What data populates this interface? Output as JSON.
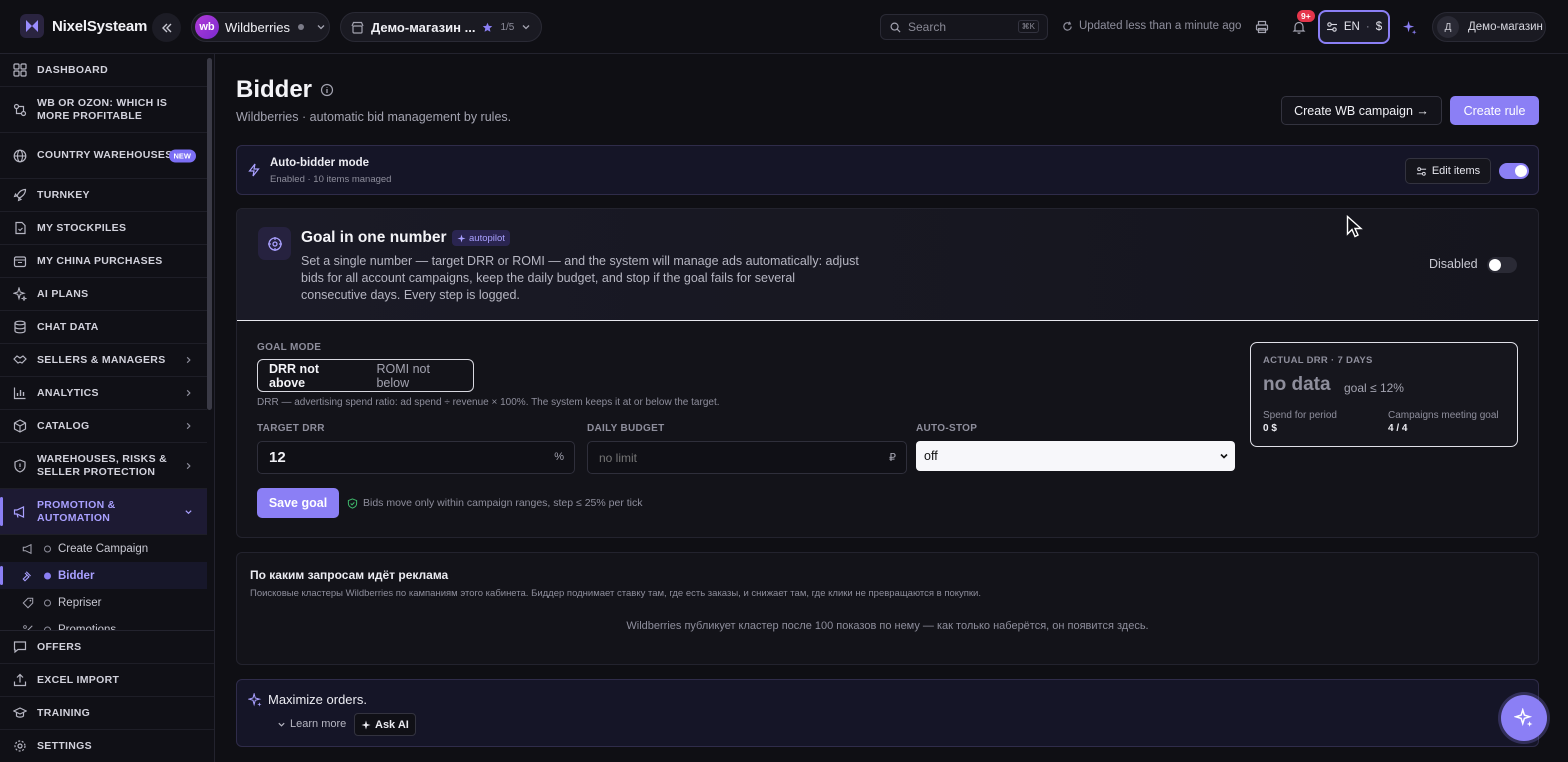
{
  "app": {
    "name": "NixelSysteam"
  },
  "topbar": {
    "marketplace": {
      "badge": "wb",
      "label": "Wildberries"
    },
    "store": {
      "label": "Демо-магазин ...",
      "count": "1/5"
    },
    "search": {
      "placeholder": "Search",
      "shortcut": "⌘K"
    },
    "updated": "Updated less than a minute ago",
    "notifications_badge": "9+",
    "lang": "EN",
    "currency": "$",
    "user": {
      "initial": "Д",
      "name": "Демо-магазин"
    }
  },
  "sidebar": {
    "items": [
      {
        "label": "Dashboard",
        "icon": "grid-icon"
      },
      {
        "label": "WB or Ozon: which is more profitable",
        "icon": "compare-icon"
      },
      {
        "label": "Country warehouses",
        "icon": "globe-icon",
        "badge": "NEW"
      },
      {
        "label": "Turnkey",
        "icon": "rocket-icon"
      },
      {
        "label": "My stockpiles",
        "icon": "box-icon"
      },
      {
        "label": "My China purchases",
        "icon": "bag-icon"
      },
      {
        "label": "AI plans",
        "icon": "sparkle-icon"
      },
      {
        "label": "Chat data",
        "icon": "database-icon"
      },
      {
        "label": "Sellers & managers",
        "icon": "handshake-icon"
      },
      {
        "label": "Analytics",
        "icon": "chart-icon"
      },
      {
        "label": "Catalog",
        "icon": "package-icon"
      },
      {
        "label": "Warehouses, risks & seller protection",
        "icon": "shield-icon"
      },
      {
        "label": "Promotion & automation",
        "icon": "megaphone-icon"
      }
    ],
    "sub_items": [
      {
        "label": "Create Campaign"
      },
      {
        "label": "Bidder"
      },
      {
        "label": "Repriser"
      },
      {
        "label": "Promotions"
      }
    ],
    "bottom_items": [
      {
        "label": "Offers"
      },
      {
        "label": "Excel import"
      },
      {
        "label": "Training"
      },
      {
        "label": "Settings"
      }
    ]
  },
  "page": {
    "title": "Bidder",
    "subtitle": "Wildberries · automatic bid management by rules.",
    "create_wb_campaign": "Create WB campaign →",
    "create_rule": "Create rule"
  },
  "auto_bidder": {
    "title": "Auto-bidder mode",
    "subtitle": "Enabled · 10 items managed",
    "edit_label": "Edit items",
    "enabled": true
  },
  "goal": {
    "title": "Goal in one number",
    "badge": "autopilot",
    "description": "Set a single number — target DRR or ROMI — and the system will manage ads automatically: adjust bids for all account campaigns, keep the daily budget, and stop if the goal fails for several consecutive days. Every step is logged.",
    "status_label": "Disabled",
    "enabled": false,
    "mode_label": "GOAL MODE",
    "mode_options": [
      "DRR not above",
      "ROMI not below"
    ],
    "mode_hint": "DRR — advertising spend ratio: ad spend ÷ revenue × 100%. The system keeps it at or below the target.",
    "target_label": "TARGET DRR",
    "target_value": "12",
    "target_suffix": "%",
    "budget_label": "DAILY BUDGET",
    "budget_placeholder": "no limit",
    "budget_suffix": "₽",
    "autostop_label": "AUTO-STOP",
    "autostop_value": "off",
    "save_label": "Save goal",
    "save_hint": "Bids move only within campaign ranges, step ≤ 25% per tick"
  },
  "actual": {
    "label": "ACTUAL DRR · 7 DAYS",
    "value": "no data",
    "goal": "goal ≤ 12%",
    "spend_label": "Spend for period",
    "spend_value": "0 $",
    "campaigns_label": "Campaigns meeting goal",
    "campaigns_value": "4 / 4"
  },
  "queries": {
    "title": "По каким запросам идёт реклама",
    "subtitle": "Поисковые кластеры Wildberries по кампаниям этого кабинета. Биддер поднимает ставку там, где есть заказы, и снижает там, где клики не превращаются в покупки.",
    "empty": "Wildberries публикует кластер после 100 показов по нему — как только наберётся, он появится здесь."
  },
  "ai": {
    "title": "Maximize orders.",
    "learn_more": "Learn more",
    "ask": "Ask AI"
  },
  "colors": {
    "accent": "#8b7ff5",
    "background": "#0f0f14",
    "notify": "#e5364b"
  }
}
